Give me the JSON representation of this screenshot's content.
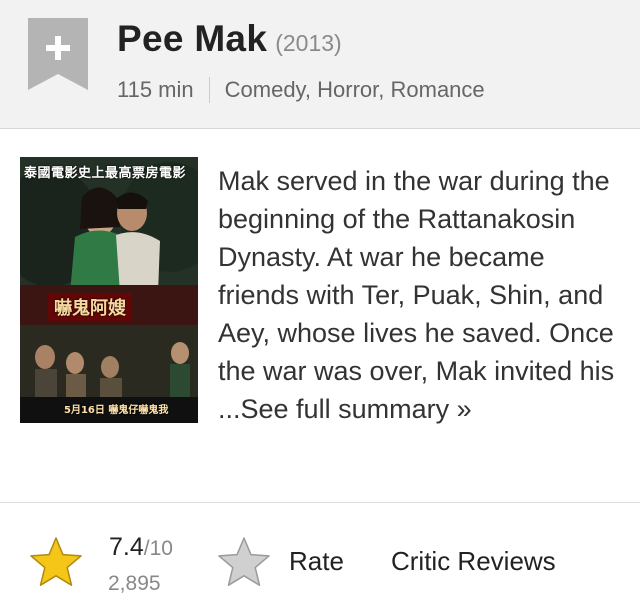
{
  "movie": {
    "title": "Pee Mak",
    "year": "(2013)",
    "runtime": "115 min",
    "genres": "Comedy, Horror, Romance"
  },
  "watchlist": {
    "icon": "plus-ribbon-icon",
    "color": "#b4b4b4"
  },
  "poster": {
    "top_text": "泰國電影史上最高票房電影",
    "title_text": "嚇鬼阿嫂",
    "date_text": "5月16日 嚇鬼仔嚇鬼我"
  },
  "summary": {
    "text": "Mak served in the war during the beginning of the Rattanakosin Dynasty. At war he became friends with Ter, Puak, Shin, and Aey, whose lives he saved. Once the war was over, Mak invited his ...",
    "more_link": "See full summary »"
  },
  "rating": {
    "score": "7.4",
    "max": "/10",
    "count": "2,895",
    "star_color": "#f5c518"
  },
  "actions": {
    "rate_label": "Rate",
    "critic_label": "Critic Reviews",
    "rate_star_color": "#d0d0d0"
  }
}
